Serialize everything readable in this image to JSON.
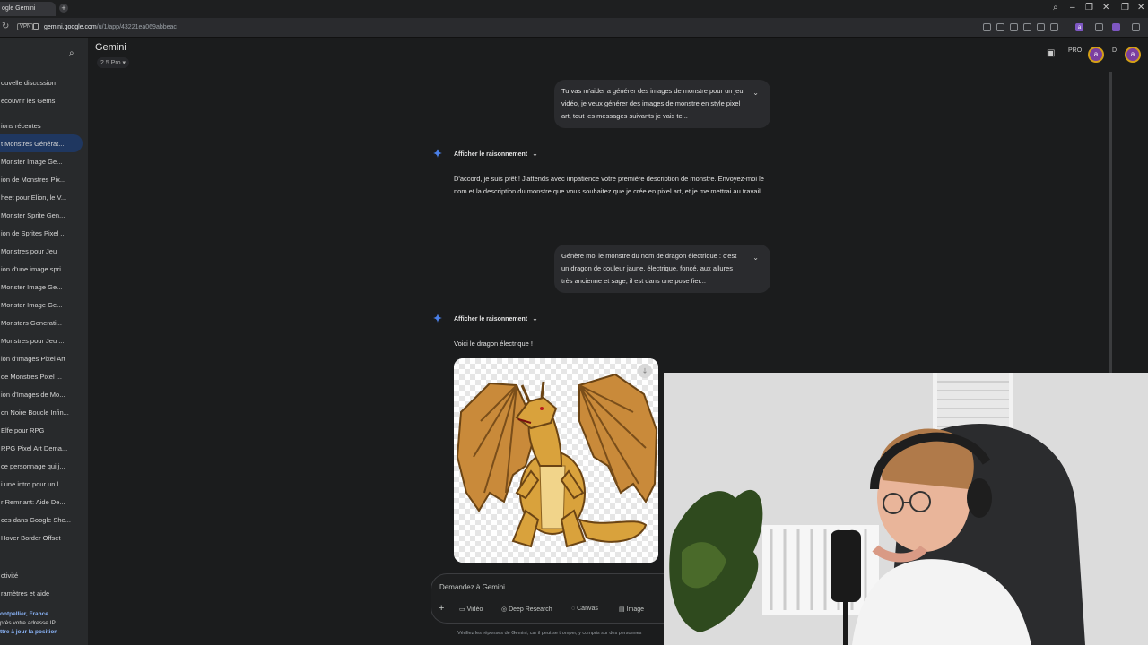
{
  "browser": {
    "tab_title": "ogle Gemini",
    "new_tab": "+",
    "url_domain": "gemini.google.com",
    "url_path": "/u/1/app/43221ea069abbeac",
    "vpn_label": "VPN",
    "extension_avatar": "a"
  },
  "sidebar": {
    "items": [
      "ouvelle discussion",
      "ecouvrir les Gems",
      "ions récentes",
      "t Monstres Générat...",
      "Monster Image Ge...",
      "ion de Monstres Pix...",
      "heet pour Elion, le V...",
      "Monster Sprite Gen...",
      "ion de Sprites Pixel ...",
      "Monstres pour Jeu",
      "ion d'une image spri...",
      "Monster Image Ge...",
      "Monster Image Ge...",
      "Monsters Generati...",
      "Monstres pour Jeu ...",
      "ion d'Images Pixel Art",
      "de Monstres Pixel ...",
      "ion d'Images de Mo...",
      "on Noire Boucle Infin...",
      "Elfe pour RPG",
      "RPG Pixel Art Dema...",
      "ce personnage qui j...",
      "i une intro pour un l...",
      "r Remnant: Aide De...",
      "ces dans Google She...",
      "Hover Border Offset"
    ],
    "activity": "ctivité",
    "settings": "ramètres et aide",
    "location_city": "ontpellier, France",
    "location_source": "près votre adresse IP",
    "location_update": "ttre à jour la position"
  },
  "header": {
    "app_title": "Gemini",
    "model": "2.5 Pro",
    "pro_badge": "PRO",
    "avatar_letter": "a",
    "d_label": "D"
  },
  "chat": {
    "user_msg_1": "Tu vas m'aider a générer des images de monstre pour un jeu vidéo, je veux générer des images de monstre en style pixel art, tout les messages suivants je vais te...",
    "show_reasoning": "Afficher le raisonnement",
    "model_resp_1": "D'accord, je suis prêt ! J'attends avec impatience votre première description de monstre. Envoyez-moi le nom et la description du monstre que vous souhaitez que je crée en pixel art, et je me mettrai au travail.",
    "user_msg_2": "Génère moi le monstre du nom de dragon électrique : c'est un dragon de couleur jaune, électrique, foncé, aux allures très ancienne et sage, il est dans une pose fier...",
    "model_resp_2": "Voici le dragon électrique !"
  },
  "composer": {
    "placeholder": "Demandez à Gemini",
    "add": "+",
    "tools": [
      "Vidéo",
      "Deep Research",
      "Canvas",
      "Image"
    ],
    "disclaimer": "Vérifiez les réponses de Gemini, car il peut se tromper, y compris sur des personnes"
  },
  "colors": {
    "accent_blue": "#8ab4f8",
    "active_item": "#1f3760",
    "gemini_spark": "#4a7fe8"
  }
}
